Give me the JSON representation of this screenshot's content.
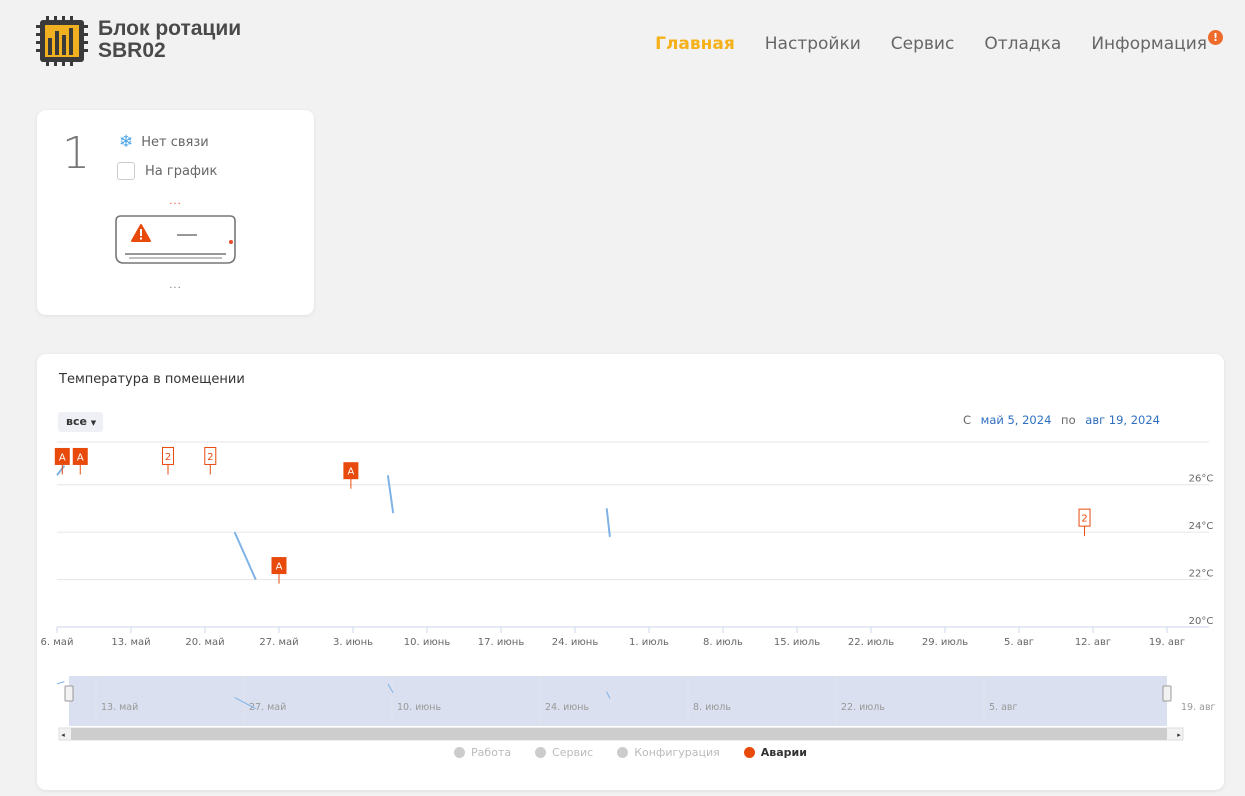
{
  "app": {
    "title_line1": "Блок ротации",
    "title_line2": "SBR02"
  },
  "nav": {
    "items": [
      {
        "label": "Главная",
        "active": true
      },
      {
        "label": "Настройки",
        "active": false
      },
      {
        "label": "Сервис",
        "active": false
      },
      {
        "label": "Отладка",
        "active": false
      },
      {
        "label": "Информация",
        "active": false,
        "badge": "!"
      }
    ]
  },
  "unit": {
    "number": "1",
    "status_icon": "snowflake-icon",
    "status": "Нет связи",
    "checkbox_label": "На график",
    "checkbox_checked": false,
    "dots_top": "...",
    "dots_bottom": "..."
  },
  "chart_section": {
    "title": "Температура в помещении",
    "range_button": "все",
    "date_from_label": "С",
    "date_from": "май 5, 2024",
    "date_to_label": "по",
    "date_to": "авг 19, 2024",
    "legend": [
      {
        "label": "Работа",
        "active": false
      },
      {
        "label": "Сервис",
        "active": false
      },
      {
        "label": "Конфигурация",
        "active": false
      },
      {
        "label": "Аварии",
        "active": true
      }
    ]
  },
  "chart_data": {
    "type": "line",
    "x_ticks": [
      "6. май",
      "13. май",
      "20. май",
      "27. май",
      "3. июнь",
      "10. июнь",
      "17. июнь",
      "24. июнь",
      "1. июль",
      "8. июль",
      "15. июль",
      "22. июль",
      "29. июль",
      "5. авг",
      "12. авг",
      "19. авг"
    ],
    "y_ticks": [
      "20°C",
      "22°C",
      "24°C",
      "26°C"
    ],
    "ylim": [
      20,
      27.8
    ],
    "xlim_days": [
      0,
      105
    ],
    "series": [
      {
        "segments": [
          {
            "x": [
              0.0,
              0.7
            ],
            "y": [
              26.4,
              26.8
            ]
          },
          {
            "x": [
              16.8,
              18.8
            ],
            "y": [
              24.0,
              22.0
            ]
          },
          {
            "x": [
              31.3,
              31.8
            ],
            "y": [
              26.4,
              24.8
            ]
          },
          {
            "x": [
              52.0,
              52.3
            ],
            "y": [
              25.0,
              23.8
            ]
          }
        ]
      }
    ],
    "flags": [
      {
        "day": 0.5,
        "text": "A",
        "type": "filled",
        "y": 26.6
      },
      {
        "day": 2.2,
        "text": "A",
        "type": "filled",
        "y": 26.6
      },
      {
        "day": 10.5,
        "text": "2",
        "type": "outline",
        "y": 26.6
      },
      {
        "day": 14.5,
        "text": "2",
        "type": "outline",
        "y": 26.6
      },
      {
        "day": 27.8,
        "text": "A",
        "type": "filled",
        "y": 26.0
      },
      {
        "day": 21.0,
        "text": "A",
        "type": "filled",
        "y": 22.0
      },
      {
        "day": 97.2,
        "text": "2",
        "type": "outline",
        "y": 24.0
      }
    ],
    "navigator_labels": [
      "13. май",
      "27. май",
      "10. июнь",
      "24. июнь",
      "8. июль",
      "22. июль",
      "5. авг",
      "19. авг"
    ],
    "colors": {
      "line": "#7fb2e6",
      "alarm": "#e84a0c",
      "navigator_fill": "#cdd6ea"
    }
  }
}
